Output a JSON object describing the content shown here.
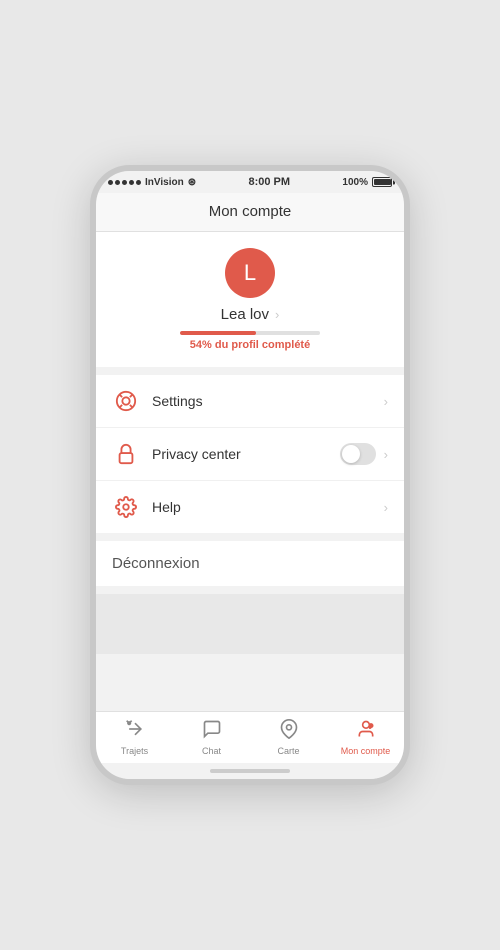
{
  "statusBar": {
    "carrier": "InVision",
    "time": "8:00 PM",
    "battery": "100%"
  },
  "pageHeader": {
    "title": "Mon compte"
  },
  "profile": {
    "avatarLetter": "L",
    "name": "Lea lov",
    "progressPercent": 54,
    "progressWidth": "54%",
    "progressLabel": "du profil complété",
    "progressHighlight": "54%"
  },
  "menuItems": [
    {
      "id": "settings",
      "icon": "lifebuoy",
      "label": "Settings",
      "hasToggle": false
    },
    {
      "id": "privacy",
      "icon": "lock",
      "label": "Privacy center",
      "hasToggle": true
    },
    {
      "id": "help",
      "icon": "gear",
      "label": "Help",
      "hasToggle": false
    }
  ],
  "deconnexion": {
    "label": "Déconnexion"
  },
  "tabBar": {
    "items": [
      {
        "id": "trajets",
        "label": "Trajets",
        "icon": "wand",
        "active": false
      },
      {
        "id": "chat",
        "label": "Chat",
        "icon": "chat",
        "active": false
      },
      {
        "id": "carte",
        "label": "Carte",
        "icon": "map",
        "active": false
      },
      {
        "id": "moncompte",
        "label": "Mon compte",
        "icon": "person",
        "active": true
      }
    ]
  }
}
